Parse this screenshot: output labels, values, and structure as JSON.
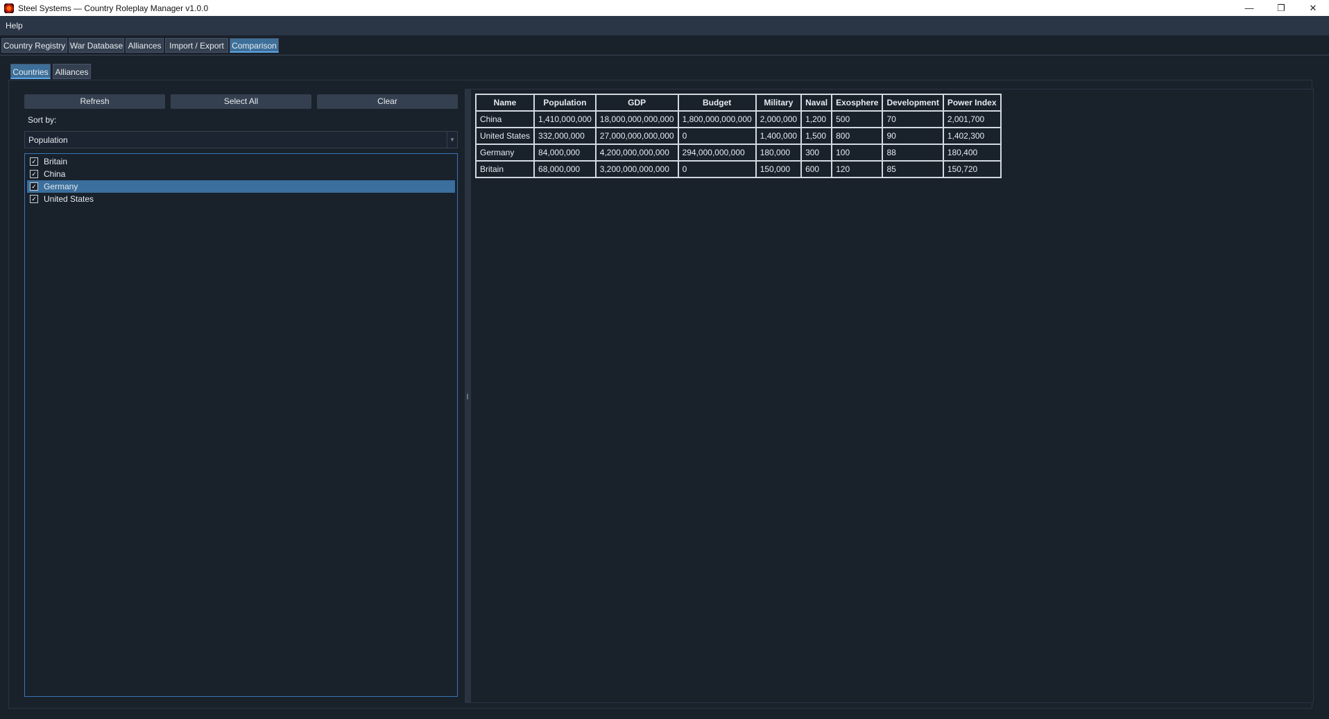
{
  "window": {
    "title": "Steel Systems — Country Roleplay Manager v1.0.0",
    "controls": {
      "minimize": "—",
      "maximize": "❐",
      "close": "✕"
    }
  },
  "menu": {
    "help": "Help"
  },
  "main_tabs": [
    {
      "label": "Country Registry"
    },
    {
      "label": "War Database"
    },
    {
      "label": "Alliances"
    },
    {
      "label": "Import / Export"
    },
    {
      "label": "Comparison",
      "active": true
    }
  ],
  "sub_tabs": [
    {
      "label": "Countries",
      "active": true
    },
    {
      "label": "Alliances"
    }
  ],
  "toolbar": {
    "refresh": "Refresh",
    "select_all": "Select All",
    "clear": "Clear"
  },
  "sort": {
    "label": "Sort by:",
    "value": "Population"
  },
  "countries": [
    {
      "name": "Britain",
      "checked": true
    },
    {
      "name": "China",
      "checked": true
    },
    {
      "name": "Germany",
      "checked": true,
      "selected": true
    },
    {
      "name": "United States",
      "checked": true
    }
  ],
  "table": {
    "headers": [
      "Name",
      "Population",
      "GDP",
      "Budget",
      "Military",
      "Naval",
      "Exosphere",
      "Development",
      "Power Index"
    ],
    "rows": [
      [
        "China",
        "1,410,000,000",
        "18,000,000,000,000",
        "1,800,000,000,000",
        "2,000,000",
        "1,200",
        "500",
        "70",
        "2,001,700"
      ],
      [
        "United States",
        "332,000,000",
        "27,000,000,000,000",
        "0",
        "1,400,000",
        "1,500",
        "800",
        "90",
        "1,402,300"
      ],
      [
        "Germany",
        "84,000,000",
        "4,200,000,000,000",
        "294,000,000,000",
        "180,000",
        "300",
        "100",
        "88",
        "180,400"
      ],
      [
        "Britain",
        "68,000,000",
        "3,200,000,000,000",
        "0",
        "150,000",
        "600",
        "120",
        "85",
        "150,720"
      ]
    ]
  },
  "colors": {
    "background": "#19212b",
    "accent": "#3d6f99",
    "selection": "#3b6f9d",
    "button": "#34404f"
  }
}
